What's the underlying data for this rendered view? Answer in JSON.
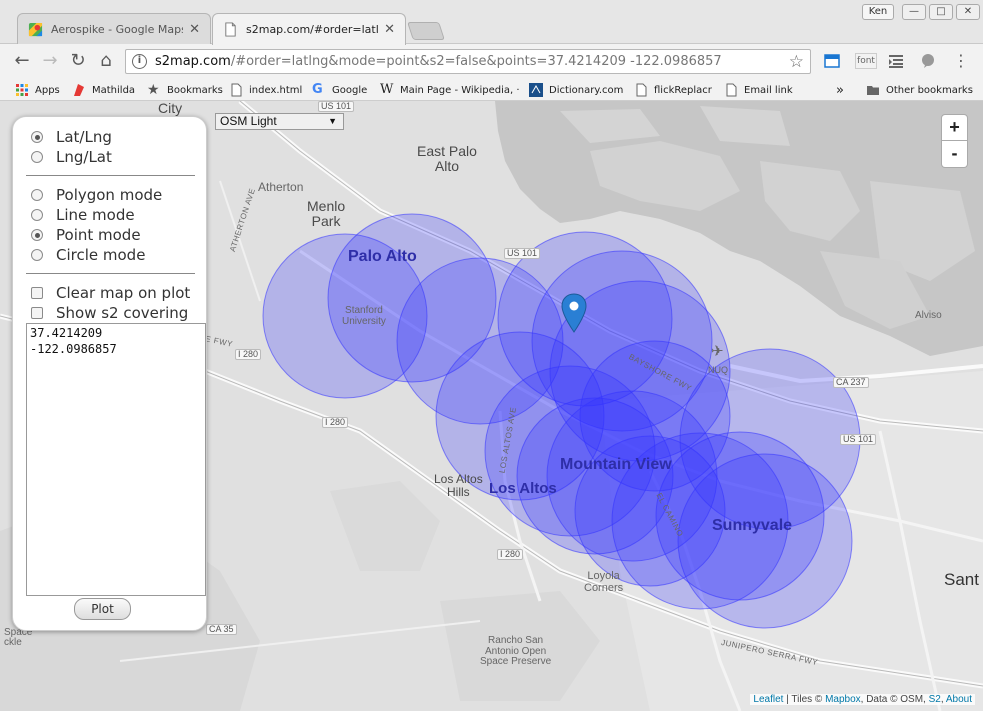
{
  "tabs": [
    {
      "title": "Aerospike - Google Maps",
      "active": false
    },
    {
      "title": "s2map.com/#order=latlng&",
      "active": true
    }
  ],
  "window": {
    "profile": "Ken",
    "minimize": "—",
    "maximize": "□",
    "close": "✕"
  },
  "toolbar": {
    "url_host": "s2map.com",
    "url_path": "/#order=latlng&mode=point&s2=false&points=37.4214209 -122.0986857",
    "font_ext_label": "font"
  },
  "bookmarks": [
    {
      "label": "Apps",
      "icon": "apps-grid-icon"
    },
    {
      "label": "Mathilda",
      "icon": "mathilda-icon"
    },
    {
      "label": "Bookmarks",
      "icon": "star-icon"
    },
    {
      "label": "index.html",
      "icon": "page-icon"
    },
    {
      "label": "Google",
      "icon": "google-icon"
    },
    {
      "label": "Main Page - Wikipedia, ·",
      "icon": "wikipedia-icon"
    },
    {
      "label": "Dictionary.com",
      "icon": "dictionary-icon"
    },
    {
      "label": "flickReplacr",
      "icon": "page-icon"
    },
    {
      "label": "Email link",
      "icon": "page-icon"
    }
  ],
  "bookmarks_overflow": "»",
  "other_bookmarks": "Other bookmarks",
  "map": {
    "tileset": "OSM Light",
    "zoom_in": "+",
    "zoom_out": "-",
    "marker_count": 1,
    "marker_color": "#2a7fd4",
    "circle_fill": "#3333ff",
    "labels": {
      "east_palo_alto": "East Palo\nAlto",
      "atherton": "Atherton",
      "menlo_park": "Menlo\nPark",
      "palo_alto": "Palo Alto",
      "stanford": "Stanford\nUniversity",
      "mountain_view": "Mountain View",
      "los_altos": "Los Altos",
      "los_altos_hills": "Los Altos\nHills",
      "sunnyvale": "Sunnyvale",
      "loyola_corners": "Loyola\nCorners",
      "rancho_san_antonio": "Rancho San\nAntonio Open\nSpace Preserve",
      "alviso": "Alviso",
      "nuq": "NUQ",
      "city_top": "City",
      "santa_clara_partial": "Sant",
      "space_partial": "Space",
      "ckle_partial": "ckle",
      "atherton_ave": "ATHERTON AVE",
      "bayshore_fwy": "BAYSHORE FWY",
      "junipero_serra_fwy": "JUNIPERO SERRA FWY",
      "el_fwy": "E FWY",
      "los_altos_ave": "LOS ALTOS AVE",
      "el_camino": "EL CAMINO"
    },
    "shields": {
      "us101_top": "US 101",
      "us101_mid": "US 101",
      "us101_east": "US 101",
      "i280_west": "I 280",
      "i280_mid": "I 280",
      "i280_south": "I 280",
      "ca237": "CA 237",
      "ca35": "CA 35"
    },
    "attribution": {
      "leaflet": "Leaflet",
      "tiles_text": " | Tiles © ",
      "mapbox": "Mapbox",
      "data_text": ", Data © OSM, ",
      "s2": "S2",
      "sep": ", ",
      "about": "About"
    }
  },
  "panel": {
    "order_options": [
      {
        "label": "Lat/Lng",
        "checked": true
      },
      {
        "label": "Lng/Lat",
        "checked": false
      }
    ],
    "mode_options": [
      {
        "label": "Polygon mode",
        "checked": false
      },
      {
        "label": "Line mode",
        "checked": false
      },
      {
        "label": "Point mode",
        "checked": true
      },
      {
        "label": "Circle mode",
        "checked": false
      }
    ],
    "checkboxes": [
      {
        "label": "Clear map on plot",
        "checked": false
      },
      {
        "label": "Show s2 covering",
        "checked": false
      }
    ],
    "points_text": "37.4214209\n-122.0986857",
    "plot_label": "Plot"
  }
}
